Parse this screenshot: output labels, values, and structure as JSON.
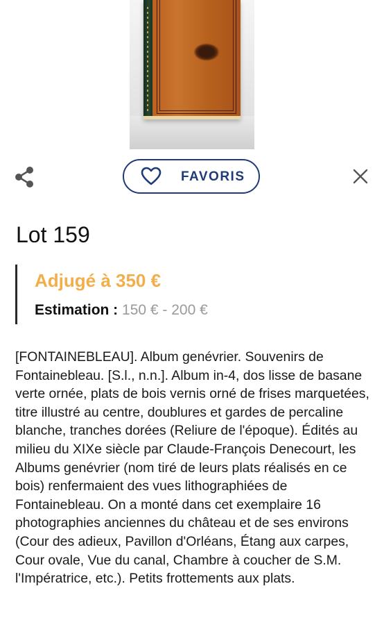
{
  "favorites_button": {
    "label": "FAVORIS",
    "icon": "heart-icon"
  },
  "toolbar": {
    "share_icon": "share-icon",
    "close_icon": "close-icon"
  },
  "lot": {
    "title": "Lot 159",
    "result": "Adjugé à 350 €",
    "estimation_label": "Estimation :",
    "estimation_value": "150 € - 200 €",
    "description": "[FONTAINEBLEAU]. Album genévrier. Souvenirs de Fontainebleau. [S.l., n.n.].  Album in-4, dos lisse de basane verte ornée, plats de bois vernis orné de frises marquetées, titre illustré au centre, doublures et gardes de percaline blanche, tranches dorées (Reliure de l'époque).  Édités au milieu du XIXe siècle par Claude-François Denecourt, les Albums genévrier (nom tiré de leurs plats réalisés en ce bois) renfermaient des vues lithographiées de Fontainebleau. On a monté dans cet exemplaire 16 photographies anciennes du château et de ses environs (Cour des adieux, Pavillon d'Orléans, Étang aux carpes, Cour ovale, Vue du canal, Chambre à coucher de S.M. l'Impératrice, etc.). Petits frottements aux plats."
  },
  "colors": {
    "accent_blue": "#1f3a78",
    "result_orange": "#f2ae4b",
    "estimation_grey": "#9a9a9a"
  }
}
